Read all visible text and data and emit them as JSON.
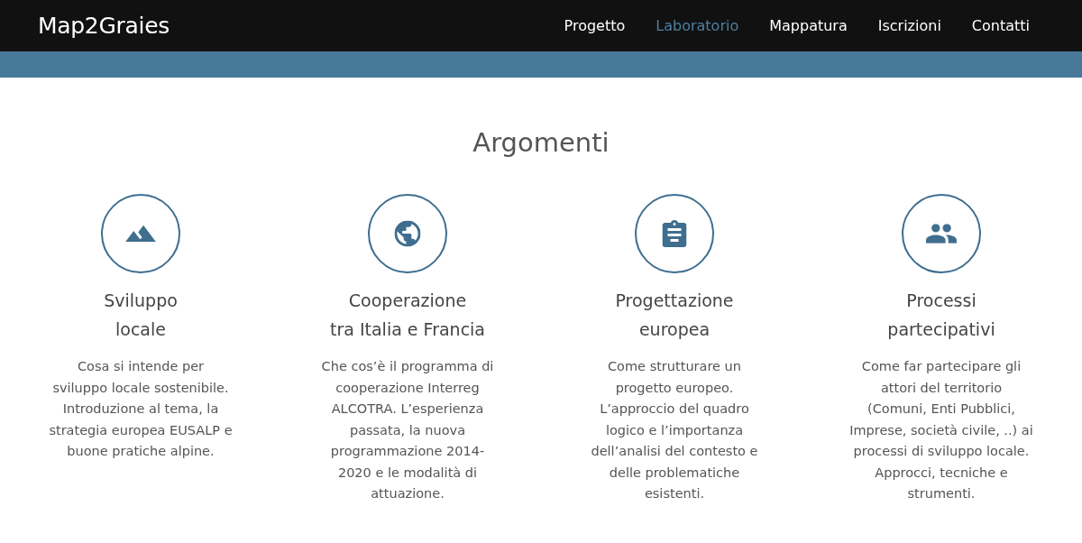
{
  "navbar": {
    "brand": "Map2Graies",
    "links": [
      {
        "label": "Progetto",
        "selected": false
      },
      {
        "label": "Laboratorio",
        "selected": true
      },
      {
        "label": "Mappatura",
        "selected": false
      },
      {
        "label": "Iscrizioni",
        "selected": false
      },
      {
        "label": "Contatti",
        "selected": false
      }
    ]
  },
  "section": {
    "heading": "Argomenti",
    "topics": [
      {
        "title": "Sviluppo\nlocale",
        "description": "Cosa si intende per\nsviluppo locale sostenibile.\nIntroduzione al tema, la\nstrategia europea EUSALP e\nbuone pratiche alpine."
      },
      {
        "title": "Cooperazione\ntra Italia e Francia",
        "description": "Che cos’è il programma di\ncooperazione Interreg\nALCOTRA. L’esperienza\npassata, la nuova\nprogrammazione 2014-\n2020 e le modalità di\nattuazione."
      },
      {
        "title": "Progettazione\neuropea",
        "description": "Come strutturare un\nprogetto europeo.\nL’approccio del quadro\nlogico e l’importanza\ndell’analisi del contesto e\ndelle problematiche\nesistenti."
      },
      {
        "title": "Processi\npartecipativi",
        "description": "Come far partecipare gli\nattori del territorio\n(Comuni, Enti Pubblici,\nImprese, società civile, ..) ai\nprocessi di sviluppo locale.\nApprocci, tecniche e\nstrumenti."
      }
    ]
  }
}
